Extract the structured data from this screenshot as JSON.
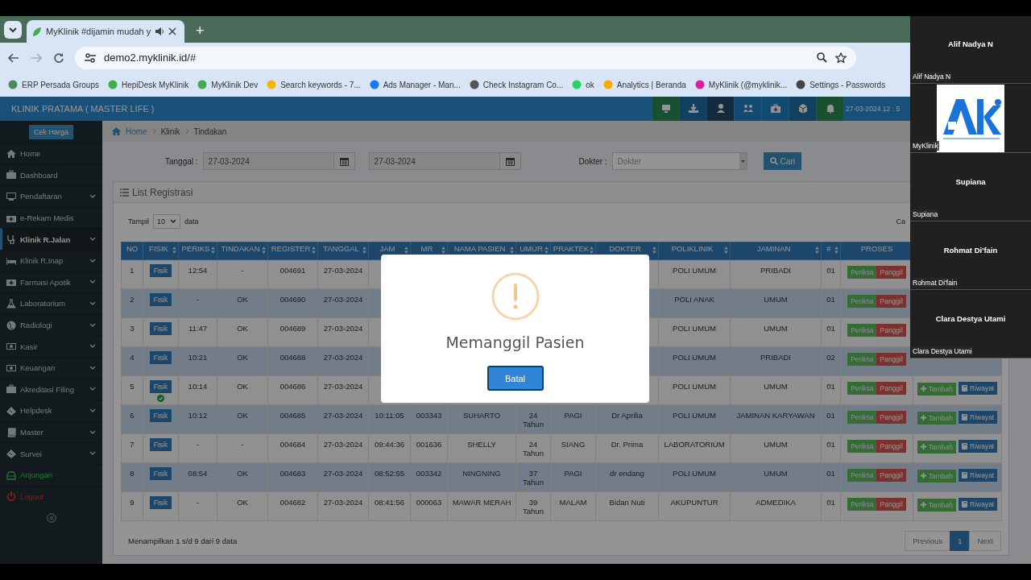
{
  "browser": {
    "tab": {
      "title": "MyKlinik #dijamin mudah y",
      "selected": true
    },
    "new_tab": "+",
    "url": "demo2.myklinik.id/#",
    "bookmarks": [
      {
        "label": "ERP Persada Groups",
        "color": "#4a8a5a"
      },
      {
        "label": "HepiDesk MyKlinik",
        "color": "#3fae49"
      },
      {
        "label": "MyKlinik Dev",
        "color": "#3fae49"
      },
      {
        "label": "Search keywords - 7...",
        "color": "#f4b400"
      },
      {
        "label": "Ads Manager - Man...",
        "color": "#1877f2"
      },
      {
        "label": "Check Instagram Co...",
        "color": "#555555"
      },
      {
        "label": "ok",
        "color": "#25d366"
      },
      {
        "label": "Analytics | Beranda",
        "color": "#f9ab00"
      },
      {
        "label": "MyKlinik (@myklinik...",
        "color": "#d6249f"
      },
      {
        "label": "Settings - Passwords",
        "color": "#444444"
      }
    ]
  },
  "page": {
    "app_title": "KLINIK PRATAMA ( MASTER LIFE )",
    "toolbar_buttons": [
      {
        "kind": "success"
      },
      {
        "kind": "primary"
      },
      {
        "kind": "dark"
      },
      {
        "kind": "info"
      },
      {
        "kind": "info"
      },
      {
        "kind": "primary"
      },
      {
        "kind": "success"
      }
    ],
    "datetime": "27-03-2024 12 : 5",
    "sidebar": {
      "top_button": "Cek Harga",
      "items": [
        {
          "label": "Home",
          "expandable": false,
          "selected": false,
          "kind": "default"
        },
        {
          "label": "Dashboard",
          "expandable": false,
          "selected": false,
          "kind": "default"
        },
        {
          "label": "Pendaftaran",
          "expandable": true,
          "selected": false,
          "kind": "default"
        },
        {
          "label": "e-Rekam Medis",
          "expandable": false,
          "selected": false,
          "kind": "default"
        },
        {
          "label": "Klinik R.Jalan",
          "expandable": true,
          "selected": true,
          "kind": "active"
        },
        {
          "label": "Klinik R.Inap",
          "expandable": true,
          "selected": false,
          "kind": "default"
        },
        {
          "label": "Farmasi Apotik",
          "expandable": true,
          "selected": false,
          "kind": "default"
        },
        {
          "label": "Laboratorium",
          "expandable": true,
          "selected": false,
          "kind": "default"
        },
        {
          "label": "Radiologi",
          "expandable": true,
          "selected": false,
          "kind": "default"
        },
        {
          "label": "Kasir",
          "expandable": true,
          "selected": false,
          "kind": "default"
        },
        {
          "label": "Keuangan",
          "expandable": true,
          "selected": false,
          "kind": "default"
        },
        {
          "label": "Akreditasi Filing",
          "expandable": true,
          "selected": false,
          "kind": "default"
        },
        {
          "label": "Helpdesk",
          "expandable": true,
          "selected": false,
          "kind": "default"
        },
        {
          "label": "Master",
          "expandable": true,
          "selected": false,
          "kind": "default"
        },
        {
          "label": "Survei",
          "expandable": true,
          "selected": false,
          "kind": "default"
        },
        {
          "label": "Anjungan",
          "expandable": false,
          "selected": false,
          "kind": "success"
        },
        {
          "label": "Logout",
          "expandable": false,
          "selected": false,
          "kind": "danger"
        }
      ]
    },
    "breadcrumb": [
      "Home",
      "Klinik",
      "Tindakan"
    ],
    "filter": {
      "date_label": "Tanggal :",
      "date_from": "27-03-2024",
      "date_to": "27-03-2024",
      "doctor_label": "Dokter :",
      "doctor_placeholder": "Dokter",
      "search_button": "Cari"
    },
    "panel_title": "List Registrasi",
    "length": {
      "before": "Tampil",
      "value": "10",
      "after": "data"
    },
    "search_label": "Ca",
    "table": {
      "columns": [
        {
          "label": "NO",
          "sortable": false
        },
        {
          "label": "FISIK",
          "sortable": true
        },
        {
          "label": "PERIKS",
          "sortable": true
        },
        {
          "label": "TINDAKAN",
          "sortable": true
        },
        {
          "label": "REGISTER",
          "sortable": true
        },
        {
          "label": "TANGGAL",
          "sortable": true
        },
        {
          "label": "JAM",
          "sortable": true
        },
        {
          "label": "MR",
          "sortable": true
        },
        {
          "label": "NAMA PASIEN",
          "sortable": true
        },
        {
          "label": "UMUR",
          "sortable": true
        },
        {
          "label": "PRAKTEK",
          "sortable": true
        },
        {
          "label": "DOKTER",
          "sortable": true
        },
        {
          "label": "POLIKLINIK",
          "sortable": true
        },
        {
          "label": "JAMINAN",
          "sortable": true
        },
        {
          "label": "#",
          "sortable": true
        },
        {
          "label": "PROSES",
          "sortable": false
        }
      ],
      "rows": [
        {
          "no": "1",
          "fisik": "Fisik",
          "checked": false,
          "periksa": "12:54",
          "tindakan": "-",
          "register": "004691",
          "tanggal": "27-03-2024",
          "poliklinik": "POLI UMUM",
          "jaminan": "PRIBADI",
          "antrian": "01",
          "examine": "Periksa",
          "call": "Panggil"
        },
        {
          "no": "2",
          "fisik": "Fisik",
          "checked": false,
          "periksa": "-",
          "tindakan": "OK",
          "register": "004690",
          "tanggal": "27-03-2024",
          "poliklinik": "POLI ANAK",
          "jaminan": "UMUM",
          "antrian": "01",
          "examine": "Periksa",
          "call": "Panggil"
        },
        {
          "no": "3",
          "fisik": "Fisik",
          "checked": false,
          "periksa": "11:47",
          "tindakan": "OK",
          "register": "004689",
          "tanggal": "27-03-2024",
          "poliklinik": "POLI UMUM",
          "jaminan": "UMUM",
          "antrian": "01",
          "examine": "Periksa",
          "call": "Panggil"
        },
        {
          "no": "4",
          "fisik": "Fisik",
          "checked": false,
          "periksa": "10:21",
          "tindakan": "OK",
          "register": "004688",
          "tanggal": "27-03-2024",
          "poliklinik": "POLI UMUM",
          "jaminan": "PRIBADI",
          "antrian": "02",
          "examine": "Periksa",
          "call": "Panggil"
        },
        {
          "no": "5",
          "fisik": "Fisik",
          "checked": true,
          "periksa": "10:14",
          "tindakan": "OK",
          "register": "004686",
          "tanggal": "27-03-2024",
          "poliklinik": "POLI UMUM",
          "jaminan": "UMUM",
          "antrian": "01",
          "examine": "Periksa",
          "call": "Panggil",
          "add": "Tambah",
          "history": "Riwayat"
        },
        {
          "no": "6",
          "fisik": "Fisik",
          "checked": false,
          "periksa": "10:12",
          "tindakan": "OK",
          "register": "004685",
          "tanggal": "27-03-2024",
          "jam": "10:11:05",
          "mr": "003343",
          "nama": "SUHARTO",
          "umur": "24 Tahun",
          "praktek": "PAGI",
          "dokter": "Dr Aprilia",
          "poliklinik": "POLI UMUM",
          "jaminan": "JAMINAN KARYAWAN",
          "antrian": "01",
          "examine": "Periksa",
          "call": "Panggil",
          "add": "Tambah",
          "history": "Riwayat"
        },
        {
          "no": "7",
          "fisik": "Fisik",
          "checked": false,
          "periksa": "-",
          "tindakan": "-",
          "register": "004684",
          "tanggal": "27-03-2024",
          "jam": "09:44:36",
          "mr": "001636",
          "nama": "SHELLY",
          "umur": "24 Tahun",
          "praktek": "SIANG",
          "dokter": "Dr. Prima",
          "poliklinik": "LABORATORIUM",
          "jaminan": "UMUM",
          "antrian": "01",
          "examine": "Periksa",
          "call": "Panggil",
          "add": "Tambah",
          "history": "Riwayat"
        },
        {
          "no": "8",
          "fisik": "Fisik",
          "checked": false,
          "periksa": "08:54",
          "tindakan": "OK",
          "register": "004683",
          "tanggal": "27-03-2024",
          "jam": "08:52:55",
          "mr": "003342",
          "nama": "NINGNING",
          "umur": "37 Tahun",
          "praktek": "PAGI",
          "dokter": "dr endang",
          "poliklinik": "POLI UMUM",
          "jaminan": "UMUM",
          "antrian": "01",
          "examine": "Periksa",
          "call": "Panggil",
          "add": "Tambah",
          "history": "Riwayat"
        },
        {
          "no": "9",
          "fisik": "Fisik",
          "checked": false,
          "periksa": "-",
          "tindakan": "OK",
          "register": "004682",
          "tanggal": "27-03-2024",
          "jam": "08:41:56",
          "mr": "000063",
          "nama": "MAWAR MERAH",
          "umur": "39 Tahun",
          "praktek": "MALAM",
          "dokter": "Bidan Nuti",
          "poliklinik": "AKUPUNTUR",
          "jaminan": "ADMEDIKA",
          "antrian": "01",
          "examine": "Periksa",
          "call": "Panggil",
          "add": "Tambah",
          "history": "Riwayat"
        }
      ]
    },
    "info": "Menampilkan 1 s/d 9 dari 9 data",
    "pagination": [
      {
        "label": "Previous",
        "selected": false
      },
      {
        "label": "1",
        "selected": true
      },
      {
        "label": "Next",
        "selected": false
      }
    ]
  },
  "dialog": {
    "title": "Memanggil Pasien",
    "button": "Batal"
  },
  "video_panel": {
    "tiles": [
      {
        "kind": "name",
        "name": "Alif Nadya N",
        "label": "Alif Nadya N"
      },
      {
        "kind": "picture",
        "label": "MyKlinik"
      },
      {
        "kind": "name",
        "name": "Supiana",
        "label": "Supiana"
      },
      {
        "kind": "name",
        "name": "Rohmat Di'fain",
        "label": "Rohmat Di'fain"
      },
      {
        "kind": "name",
        "name": "Clara Destya Utami",
        "label": "Clara Destya Utami"
      }
    ]
  }
}
